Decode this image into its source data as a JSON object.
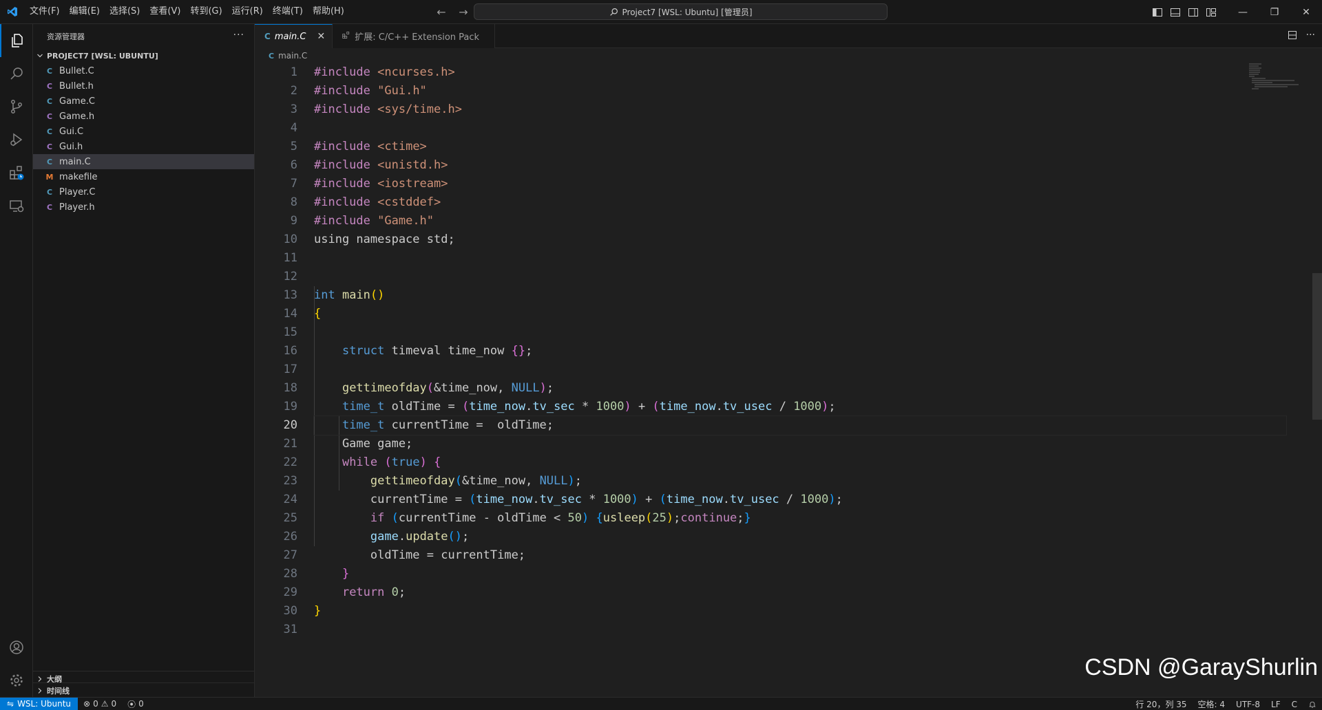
{
  "titlebar": {
    "menus": [
      "文件(F)",
      "编辑(E)",
      "选择(S)",
      "查看(V)",
      "转到(G)",
      "运行(R)",
      "终端(T)",
      "帮助(H)"
    ],
    "command_center": "Project7 [WSL: Ubuntu] [管理员]"
  },
  "sidebar": {
    "title": "资源管理器",
    "more": "···",
    "project": "PROJECT7 [WSL: UBUNTU]",
    "files": [
      {
        "name": "Bullet.C",
        "type": "C",
        "color": "#519aba"
      },
      {
        "name": "Bullet.h",
        "type": "C",
        "color": "#a074c4"
      },
      {
        "name": "Game.C",
        "type": "C",
        "color": "#519aba"
      },
      {
        "name": "Game.h",
        "type": "C",
        "color": "#a074c4"
      },
      {
        "name": "Gui.C",
        "type": "C",
        "color": "#519aba"
      },
      {
        "name": "Gui.h",
        "type": "C",
        "color": "#a074c4"
      },
      {
        "name": "main.C",
        "type": "C",
        "color": "#519aba"
      },
      {
        "name": "makefile",
        "type": "M",
        "color": "#e37933"
      },
      {
        "name": "Player.C",
        "type": "C",
        "color": "#519aba"
      },
      {
        "name": "Player.h",
        "type": "C",
        "color": "#a074c4"
      }
    ],
    "outline": "大纲",
    "timeline": "时间线"
  },
  "tabs": [
    {
      "label": "main.C",
      "icon": "C",
      "active": true
    },
    {
      "label": "扩展: C/C++ Extension Pack",
      "icon": "extensions-icon",
      "active": false
    }
  ],
  "breadcrumb": "main.C",
  "editor": {
    "current_line": 20,
    "line_numbers": [
      "1",
      "2",
      "3",
      "4",
      "5",
      "6",
      "7",
      "8",
      "9",
      "10",
      "11",
      "12",
      "13",
      "14",
      "15",
      "16",
      "17",
      "18",
      "19",
      "20",
      "21",
      "22",
      "23",
      "24",
      "25",
      "26",
      "27",
      "28",
      "29",
      "30",
      "31"
    ]
  },
  "watermark": "CSDN @GarayShurlin",
  "statusbar": {
    "remote": "WSL: Ubuntu",
    "errors": "0",
    "warnings": "0",
    "ports": "0",
    "position": "行 20，列 35",
    "spaces": "空格: 4",
    "encoding": "UTF-8",
    "eol": "LF",
    "language": "C"
  },
  "colors": {
    "accent": "#0078d4",
    "background": "#1f1f1f",
    "sidebar": "#181818"
  }
}
